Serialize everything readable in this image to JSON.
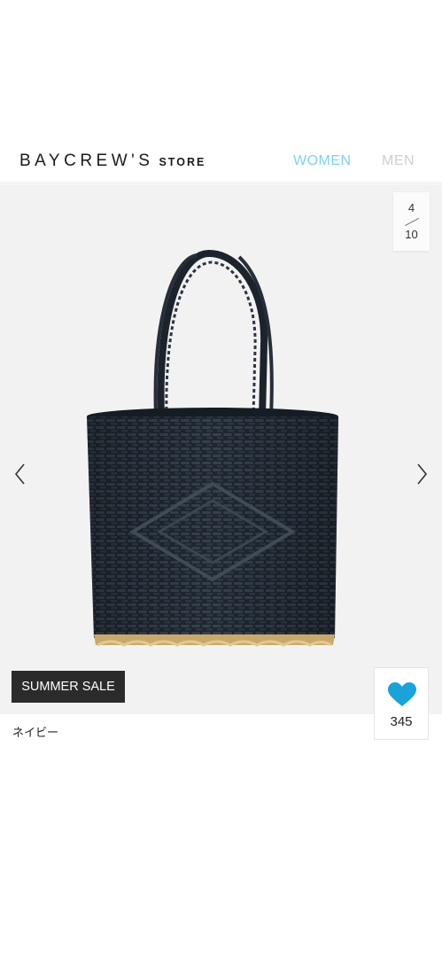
{
  "header": {
    "logo_main": "BAYCREW'S",
    "logo_sub": "STORE",
    "nav_women": "WOMEN",
    "nav_men": "MEN",
    "nav_women_color": "#7fd3e8",
    "nav_men_color": "#cfcfcf"
  },
  "gallery": {
    "current": "4",
    "total": "10",
    "prev_icon": "chevron-left-icon",
    "next_icon": "chevron-right-icon"
  },
  "product": {
    "badge": "SUMMER SALE",
    "color_name": "ネイビー"
  },
  "favorite": {
    "icon": "heart-icon",
    "count": "345",
    "heart_color": "#1aa3d9"
  }
}
